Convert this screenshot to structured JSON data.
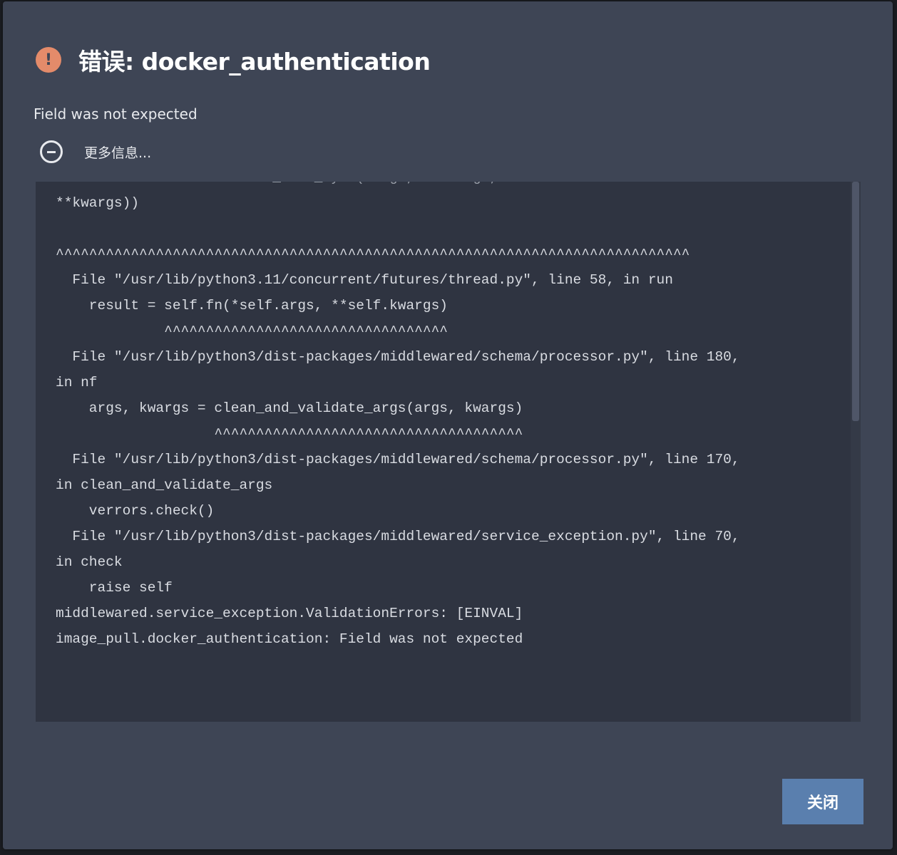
{
  "dialog": {
    "title": "错误: docker_authentication",
    "message": "Field was not expected",
    "more_info_label": "更多信息...",
    "close_label": "关闭"
  },
  "icons": {
    "error": "exclamation-circle-icon",
    "toggle": "minus-circle-icon"
  },
  "traceback": [
    "          self.middleware._call_sync(*args, **kwargs,",
    "**kwargs))",
    "",
    "^^^^^^^^^^^^^^^^^^^^^^^^^^^^^^^^^^^^^^^^^^^^^^^^^^^^^^^^^^^^^^^^^^^^^^^^^^^^",
    "  File \"/usr/lib/python3.11/concurrent/futures/thread.py\", line 58, in run",
    "    result = self.fn(*self.args, **self.kwargs)",
    "             ^^^^^^^^^^^^^^^^^^^^^^^^^^^^^^^^^^",
    "  File \"/usr/lib/python3/dist-packages/middlewared/schema/processor.py\", line 180,",
    "in nf",
    "    args, kwargs = clean_and_validate_args(args, kwargs)",
    "                   ^^^^^^^^^^^^^^^^^^^^^^^^^^^^^^^^^^^^^",
    "  File \"/usr/lib/python3/dist-packages/middlewared/schema/processor.py\", line 170,",
    "in clean_and_validate_args",
    "    verrors.check()",
    "  File \"/usr/lib/python3/dist-packages/middlewared/service_exception.py\", line 70,",
    "in check",
    "    raise self",
    "middlewared.service_exception.ValidationErrors: [EINVAL]",
    "image_pull.docker_authentication: Field was not expected"
  ],
  "colors": {
    "dialog_bg": "#3e4555",
    "trace_bg": "#2f3441",
    "error_icon": "#e48b6a",
    "button_bg": "#5a7fae"
  }
}
